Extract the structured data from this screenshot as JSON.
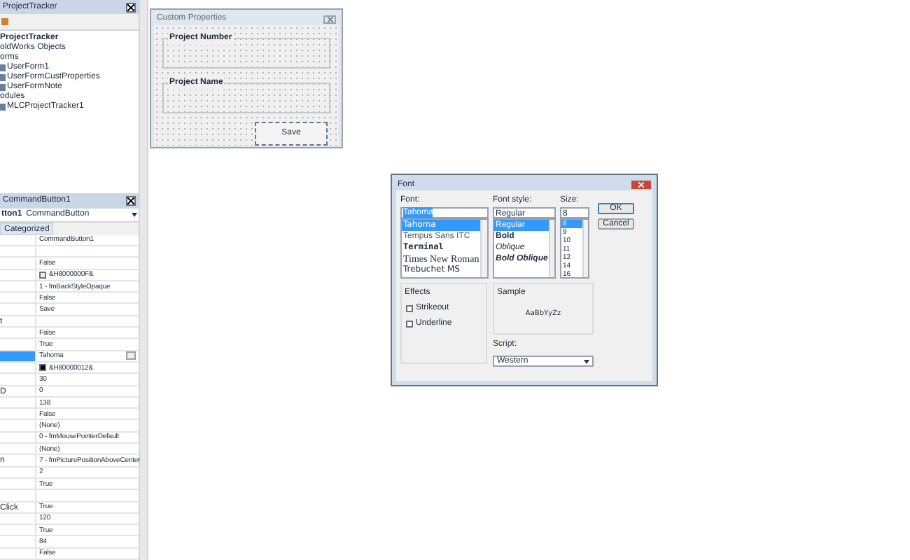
{
  "project_explorer": {
    "title": "ProjectTracker",
    "tree": [
      {
        "label": "ProjectTracker",
        "children": [
          {
            "label": "oldWorks Objects"
          },
          {
            "label": "orms",
            "children": [
              {
                "label": "UserForm1"
              },
              {
                "label": "UserFormCustProperties"
              },
              {
                "label": "UserFormNote"
              }
            ]
          },
          {
            "label": "odules",
            "children": [
              {
                "label": "MLCProjectTracker1"
              }
            ]
          }
        ]
      }
    ]
  },
  "properties": {
    "title": "CommandButton1",
    "object_name": "tton1",
    "object_type": "CommandButton",
    "tab": "Categorized",
    "rows": [
      {
        "name": "",
        "value": "CommandButton1",
        "selected": false
      },
      {
        "name": "",
        "value": "",
        "selected": false
      },
      {
        "name": "",
        "value": "False",
        "selected": false
      },
      {
        "name": "",
        "value": "&H8000000F&",
        "selected": false,
        "color": "#f0f0f0"
      },
      {
        "name": "",
        "value": "1 - fmBackStyleOpaque",
        "selected": false
      },
      {
        "name": "",
        "value": "False",
        "selected": false
      },
      {
        "name": "",
        "value": "Save",
        "selected": false
      },
      {
        "name": "t",
        "value": "",
        "selected": false
      },
      {
        "name": "",
        "value": "False",
        "selected": false
      },
      {
        "name": "",
        "value": "True",
        "selected": false
      },
      {
        "name": "",
        "value": "Tahoma",
        "selected": true
      },
      {
        "name": "",
        "value": "&H80000012&",
        "selected": false,
        "color": "#000000"
      },
      {
        "name": "",
        "value": "30",
        "selected": false
      },
      {
        "name": "D",
        "value": "0",
        "selected": false
      },
      {
        "name": "",
        "value": "138",
        "selected": false
      },
      {
        "name": "",
        "value": "False",
        "selected": false
      },
      {
        "name": "",
        "value": "(None)",
        "selected": false
      },
      {
        "name": "",
        "value": "0 - fmMousePointerDefault",
        "selected": false
      },
      {
        "name": "",
        "value": "(None)",
        "selected": false
      },
      {
        "name": "n",
        "value": "7 - fmPicturePositionAboveCenter",
        "selected": false
      },
      {
        "name": "",
        "value": "2",
        "selected": false
      },
      {
        "name": "",
        "value": "True",
        "selected": false
      },
      {
        "name": "",
        "value": "",
        "selected": false
      },
      {
        "name": "Click",
        "value": "True",
        "selected": false
      },
      {
        "name": "",
        "value": "120",
        "selected": false
      },
      {
        "name": "",
        "value": "True",
        "selected": false
      },
      {
        "name": "",
        "value": "84",
        "selected": false
      },
      {
        "name": "",
        "value": "False",
        "selected": false
      }
    ]
  },
  "user_form": {
    "title": "Custom Properties",
    "frames": [
      "Project Number",
      "Project Name"
    ],
    "button": "Save"
  },
  "font_dialog": {
    "title": "Font",
    "font_label": "Font:",
    "font_value": "Tahoma",
    "style_label": "Font style:",
    "style_value": "Regular",
    "size_label": "Size:",
    "size_value": "8",
    "fonts": [
      {
        "label": "Tahoma",
        "selected": true
      },
      {
        "label": "Tempus Sans ITC",
        "selected": false
      },
      {
        "label": "Terminal",
        "selected": false
      },
      {
        "label": "Times New Roman",
        "selected": false
      },
      {
        "label": "Trebuchet MS",
        "selected": false
      }
    ],
    "styles": [
      {
        "label": "Regular",
        "selected": true
      },
      {
        "label": "Bold",
        "selected": false
      },
      {
        "label": "Oblique",
        "selected": false
      },
      {
        "label": "Bold Oblique",
        "selected": false
      }
    ],
    "sizes": [
      {
        "label": "8",
        "selected": true
      },
      {
        "label": "9",
        "selected": false
      },
      {
        "label": "10",
        "selected": false
      },
      {
        "label": "11",
        "selected": false
      },
      {
        "label": "12",
        "selected": false
      },
      {
        "label": "14",
        "selected": false
      },
      {
        "label": "16",
        "selected": false
      }
    ],
    "buttons": [
      "OK",
      "Cancel"
    ],
    "effects_label": "Effects",
    "effects": [
      {
        "label": "Strikeout",
        "checked": false
      },
      {
        "label": "Underline",
        "checked": false
      }
    ],
    "sample_label": "Sample",
    "sample_text": "AaBbYyZz",
    "script_label": "Script:",
    "script_value": "Western"
  }
}
